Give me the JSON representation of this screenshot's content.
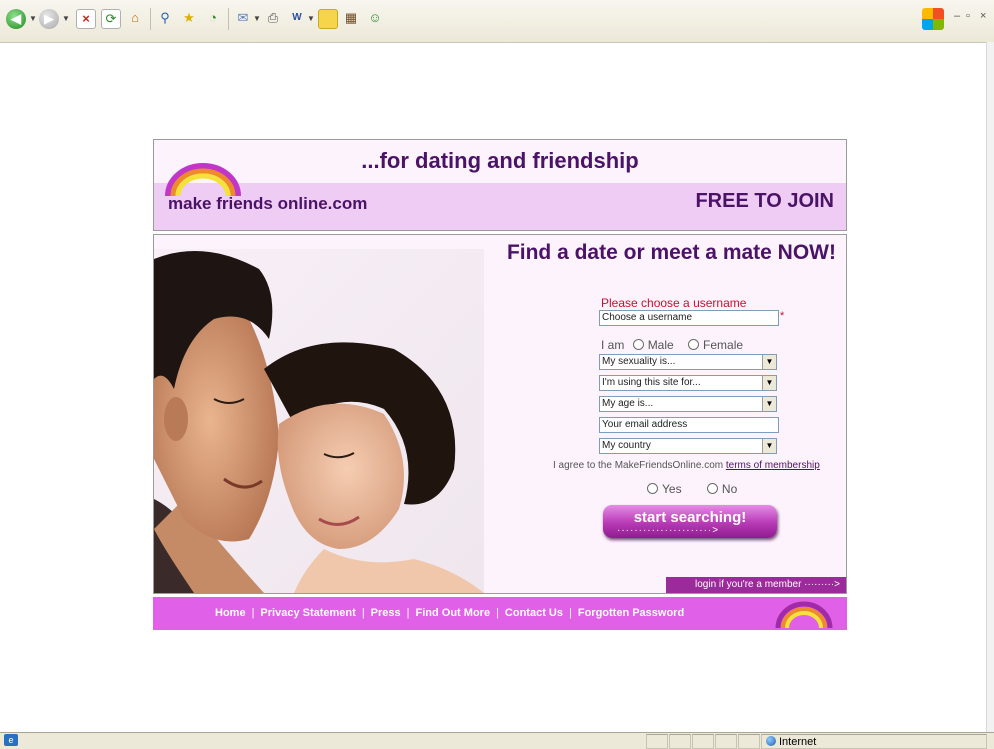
{
  "browser": {
    "toolbar_icons": [
      "back-icon",
      "forward-icon",
      "stop-icon",
      "refresh-icon",
      "home-icon",
      "search-icon",
      "favorites-icon",
      "history-icon",
      "mail-icon",
      "print-icon",
      "word-icon",
      "notes-icon",
      "research-icon",
      "messenger-icon"
    ],
    "window_controls": [
      "–",
      "▫",
      "×"
    ],
    "status": {
      "zone": "Internet"
    }
  },
  "header": {
    "tagline": "...for dating and friendship",
    "logo_text": "make friends online.com",
    "free_badge": "FREE TO JOIN"
  },
  "main": {
    "headline": "Find a date or meet a mate NOW!"
  },
  "form": {
    "username_label": "Please choose a username",
    "username_placeholder": "Choose a username",
    "required_mark": "*",
    "i_am_label": "I am",
    "gender_options": [
      "Male",
      "Female"
    ],
    "sexuality": "My sexuality is...",
    "purpose": "I'm using this site for...",
    "age": "My age is...",
    "email_placeholder": "Your email address",
    "country": "My country",
    "agree_text": "I agree to the MakeFriendsOnline.com",
    "terms_link": "terms of membership",
    "agree_options": [
      "Yes",
      "No"
    ],
    "submit_label": "start searching!",
    "submit_dots": "······················>",
    "login_link": "login if you're a member ·········>"
  },
  "footer": {
    "links": [
      "Home",
      "Privacy Statement",
      "Press",
      "Find Out More",
      "Contact Us",
      "Forgotten Password"
    ],
    "separator": "|"
  },
  "colors": {
    "brand_purple": "#4b1367",
    "header_band": "#eeccf3",
    "page_bg": "#fdf3fd",
    "footer_bg": "#e061e8",
    "login_bar": "#9b2b9b",
    "accent_red": "#c8102e"
  }
}
